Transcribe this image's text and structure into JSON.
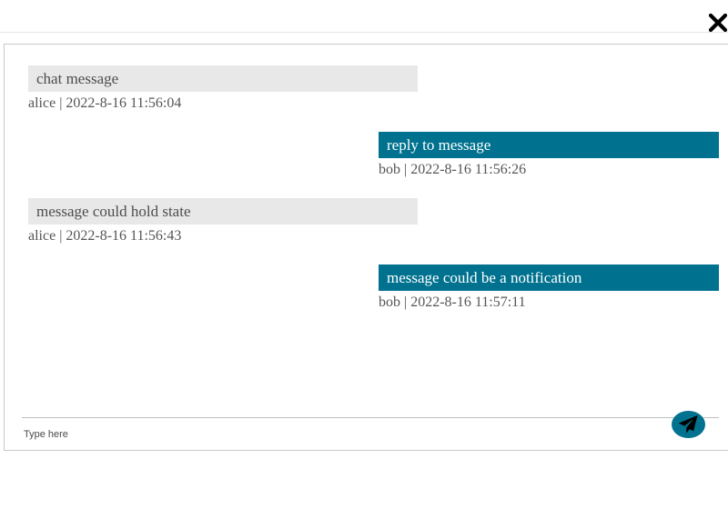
{
  "header": {
    "close_icon": "close-icon"
  },
  "messages": [
    {
      "direction": "incoming",
      "text": "chat message",
      "meta": "alice | 2022-8-16 11:56:04"
    },
    {
      "direction": "outgoing",
      "text": "reply to message",
      "meta": "bob | 2022-8-16 11:56:26"
    },
    {
      "direction": "incoming",
      "text": "message could hold state",
      "meta": "alice | 2022-8-16 11:56:43"
    },
    {
      "direction": "outgoing",
      "text": "message could be a notification",
      "meta": "bob | 2022-8-16 11:57:11"
    }
  ],
  "composer": {
    "placeholder": "Type here",
    "value": "",
    "send_icon": "paper-plane-icon"
  },
  "colors": {
    "accent": "#00728f",
    "incoming_bubble": "#e8e8e8"
  }
}
